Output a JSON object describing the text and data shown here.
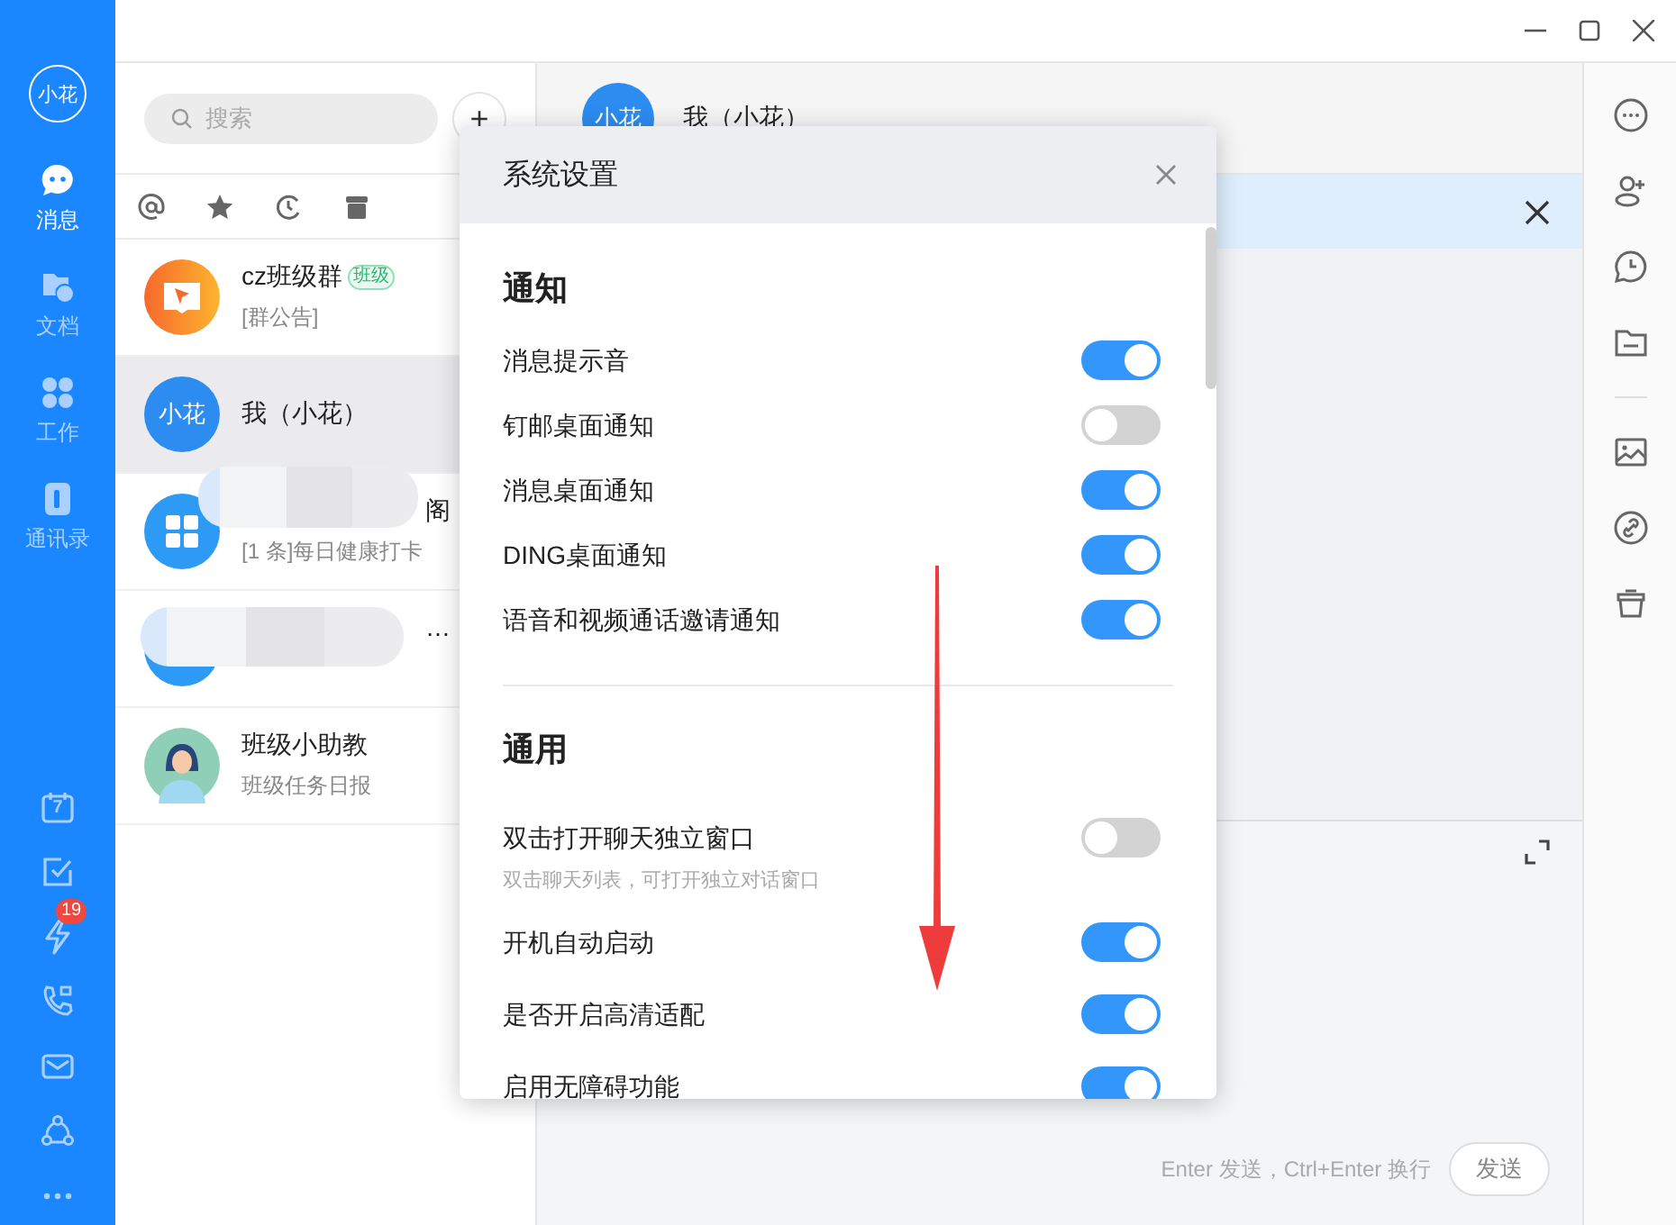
{
  "sidebar": {
    "avatar": "小花",
    "nav": [
      {
        "kind": "chat",
        "label": "消息",
        "selected": true
      },
      {
        "kind": "docs",
        "label": "文档",
        "selected": false
      },
      {
        "kind": "apps",
        "label": "工作",
        "selected": false
      },
      {
        "kind": "contacts",
        "label": "通讯录",
        "selected": false
      }
    ],
    "tools": [
      {
        "kind": "calendar",
        "text": "7"
      },
      {
        "kind": "todo"
      },
      {
        "kind": "bolt",
        "badge": "19"
      },
      {
        "kind": "call"
      },
      {
        "kind": "mail"
      },
      {
        "kind": "org"
      },
      {
        "kind": "more"
      }
    ]
  },
  "chat_list": {
    "search": {
      "placeholder": "搜索"
    },
    "add_button": "+",
    "conversations": [
      {
        "avatar": {
          "kind": "book"
        },
        "name": "cz班级群",
        "tag": "班级",
        "preview": "[群公告]",
        "selected": false,
        "redacted": false
      },
      {
        "avatar": {
          "kind": "text",
          "text": "小花"
        },
        "name": "我（小花）",
        "selected": true,
        "redacted": false
      },
      {
        "avatar": {
          "kind": "apps"
        },
        "name": "阁",
        "preview": "[1 条]每日健康打卡",
        "selected": false,
        "redacted": true
      },
      {
        "avatar": {
          "kind": "plain"
        },
        "name": "…",
        "selected": false,
        "redacted": true
      },
      {
        "avatar": {
          "kind": "person"
        },
        "name": "班级小助教",
        "preview": "班级任务日报",
        "selected": false,
        "redacted": false
      }
    ]
  },
  "chat": {
    "avatar": "小花",
    "title": "我（小花）",
    "hint": "Enter 发送，Ctrl+Enter 换行",
    "send_button": "发送"
  },
  "settings": {
    "title": "系统设置",
    "sections": [
      {
        "title": "通知",
        "items": [
          {
            "label": "消息提示音",
            "on": true
          },
          {
            "label": "钉邮桌面通知",
            "on": false
          },
          {
            "label": "消息桌面通知",
            "on": true
          },
          {
            "label": "DING桌面通知",
            "on": true
          },
          {
            "label": "语音和视频通话邀请通知",
            "on": true
          }
        ]
      },
      {
        "title": "通用",
        "items": [
          {
            "label": "双击打开聊天独立窗口",
            "description": "双击聊天列表，可打开独立对话窗口",
            "on": false
          },
          {
            "label": "开机自动启动",
            "on": true
          },
          {
            "label": "是否开启高清适配",
            "on": true
          },
          {
            "label": "启用无障碍功能",
            "on": true
          }
        ]
      }
    ]
  },
  "annotations": [
    {
      "kind": "arrow"
    }
  ]
}
